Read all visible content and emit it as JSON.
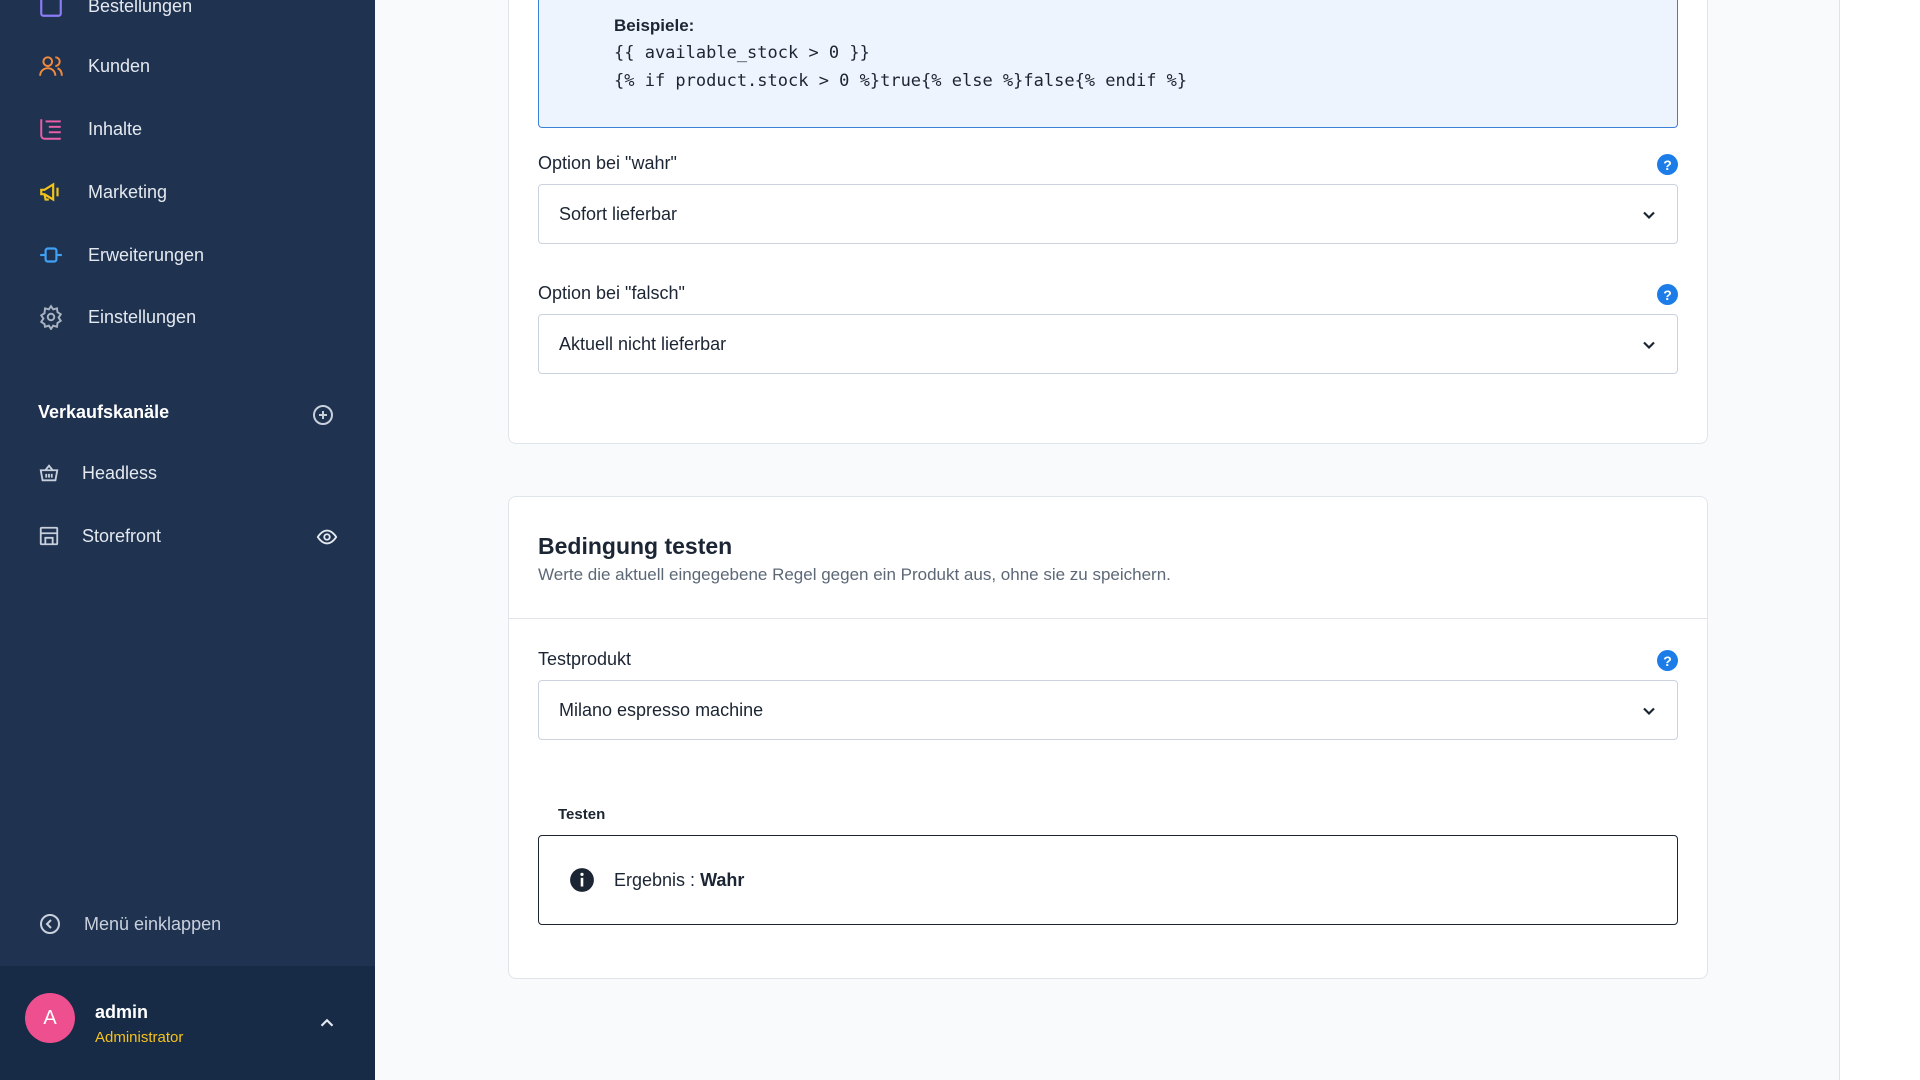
{
  "sidebar": {
    "nav": [
      {
        "label": "Bestellungen",
        "icon": "orders-icon",
        "color": "#8b7cf6"
      },
      {
        "label": "Kunden",
        "icon": "customers-icon",
        "color": "#f28a3c"
      },
      {
        "label": "Inhalte",
        "icon": "content-icon",
        "color": "#ec5fa8"
      },
      {
        "label": "Marketing",
        "icon": "marketing-icon",
        "color": "#f2c31b"
      },
      {
        "label": "Erweiterungen",
        "icon": "extensions-icon",
        "color": "#3fa2f5"
      },
      {
        "label": "Einstellungen",
        "icon": "settings-icon",
        "color": "#a9b3c1"
      }
    ],
    "sales_channels": {
      "title": "Verkaufskanäle",
      "items": [
        {
          "label": "Headless",
          "icon": "basket-icon"
        },
        {
          "label": "Storefront",
          "icon": "storefront-icon"
        }
      ]
    },
    "collapse_label": "Menü einklappen",
    "user": {
      "initial": "A",
      "name": "admin",
      "role": "Administrator"
    }
  },
  "main": {
    "examples": {
      "title": "Beispiele:",
      "lines": [
        "{{ available_stock > 0 }}",
        "{% if product.stock > 0 %}true{% else %}false{% endif %}"
      ]
    },
    "option_true": {
      "label": "Option bei \"wahr\"",
      "value": "Sofort lieferbar"
    },
    "option_false": {
      "label": "Option bei \"falsch\"",
      "value": "Aktuell nicht lieferbar"
    },
    "test_card": {
      "title": "Bedingung testen",
      "subtitle": "Werte die aktuell eingegebene Regel gegen ein Produkt aus, ohne sie zu speichern.",
      "product_label": "Testprodukt",
      "product_value": "Milano espresso machine",
      "test_label": "Testen",
      "result_prefix": "Ergebnis :",
      "result_value": "Wahr"
    },
    "help_symbol": "?"
  }
}
